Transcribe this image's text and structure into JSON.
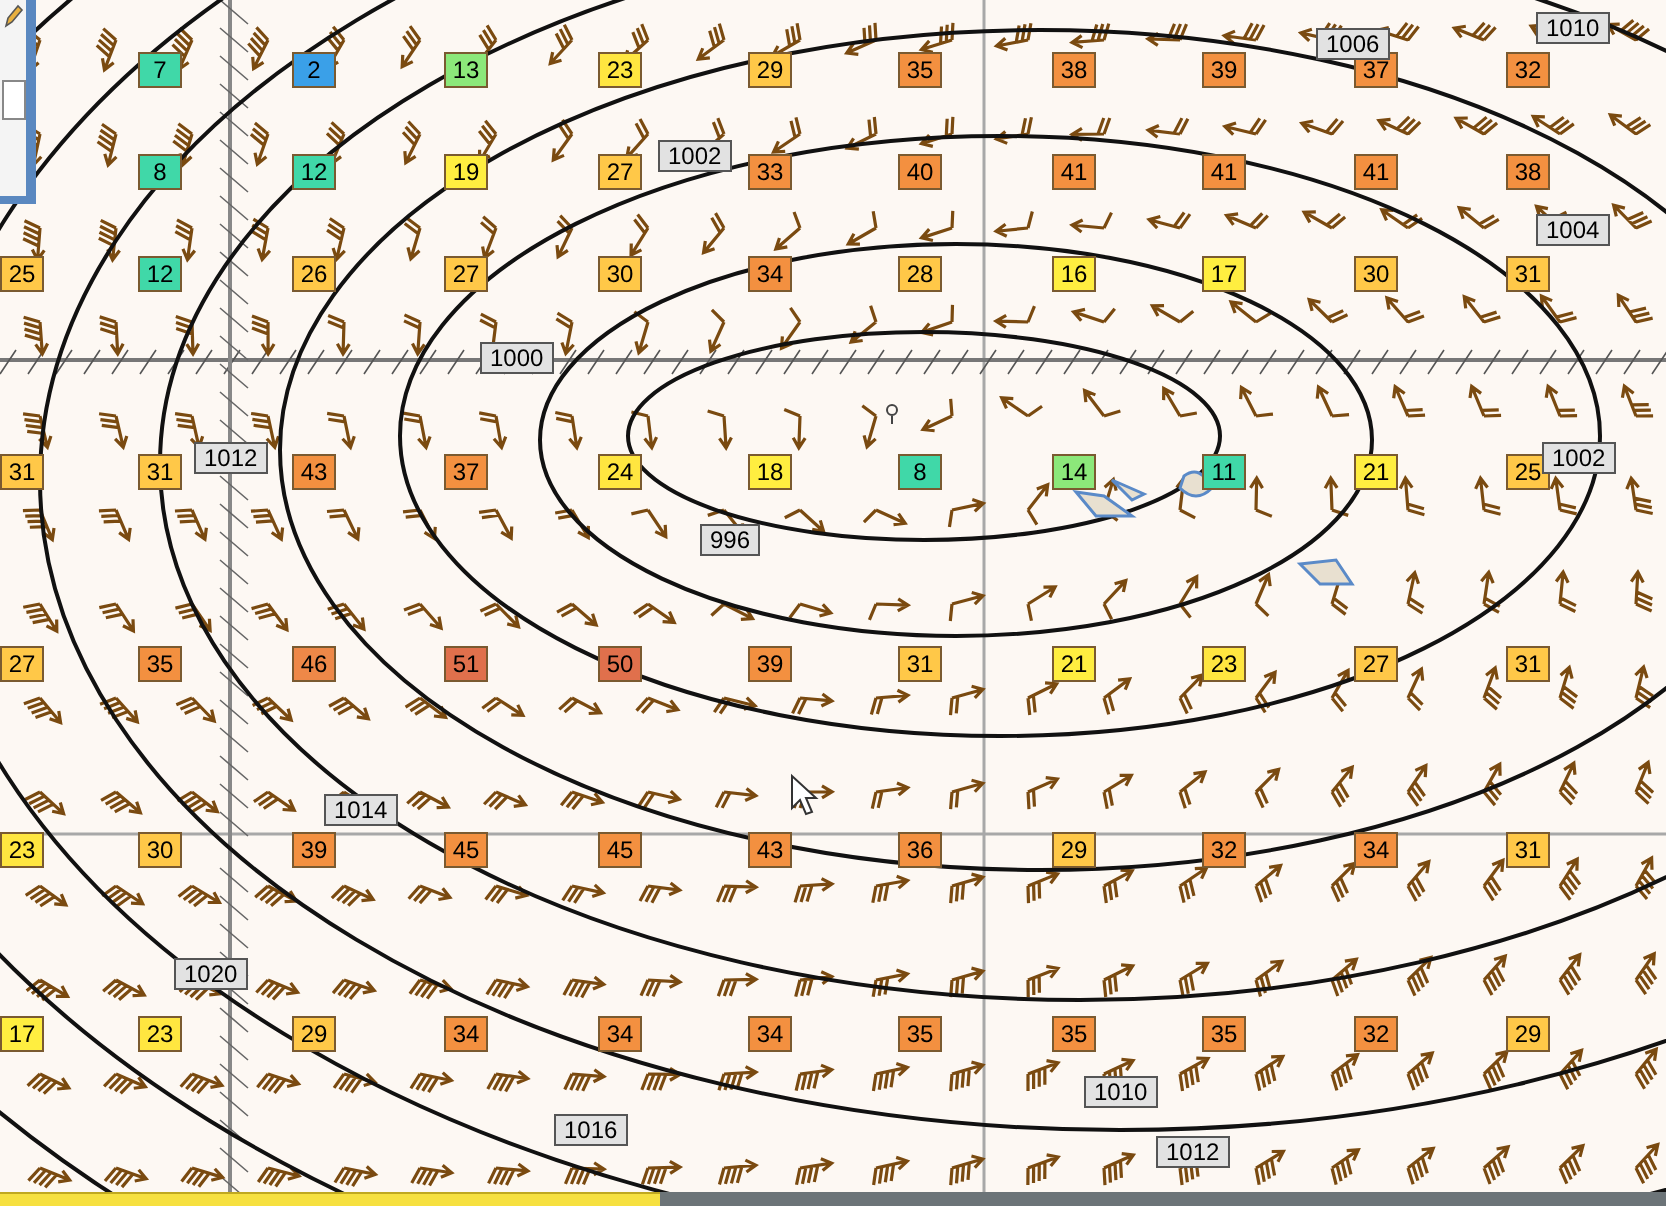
{
  "stations": [
    {
      "cells": [
        {
          "value": "7",
          "color": "#40d8a8"
        },
        {
          "value": "2",
          "color": "#3aa0e8"
        },
        {
          "value": "13",
          "color": "#8ce87a"
        },
        {
          "value": "23",
          "color": "#ffe640"
        },
        {
          "value": "29",
          "color": "#ffc848"
        },
        {
          "value": "35",
          "color": "#f39040"
        },
        {
          "value": "38",
          "color": "#f39040"
        },
        {
          "value": "39",
          "color": "#f39040"
        },
        {
          "value": "37",
          "color": "#f39040"
        },
        {
          "value": "32",
          "color": "#f39040"
        }
      ]
    },
    {
      "cells": [
        {
          "value": "8",
          "color": "#40d8a8"
        },
        {
          "value": "12",
          "color": "#40d8a8"
        },
        {
          "value": "19",
          "color": "#ffee40"
        },
        {
          "value": "27",
          "color": "#ffc848"
        },
        {
          "value": "33",
          "color": "#f39040"
        },
        {
          "value": "40",
          "color": "#f39040"
        },
        {
          "value": "41",
          "color": "#f39040"
        },
        {
          "value": "41",
          "color": "#f39040"
        },
        {
          "value": "41",
          "color": "#f39040"
        },
        {
          "value": "38",
          "color": "#f39040"
        }
      ]
    },
    {
      "cells": [
        {
          "value": "25",
          "color": "#ffc848"
        },
        {
          "value": "12",
          "color": "#40d8a8"
        },
        {
          "value": "26",
          "color": "#ffc848"
        },
        {
          "value": "27",
          "color": "#ffc848"
        },
        {
          "value": "30",
          "color": "#ffc848"
        },
        {
          "value": "34",
          "color": "#f39040"
        },
        {
          "value": "28",
          "color": "#ffc848"
        },
        {
          "value": "16",
          "color": "#ffee40"
        },
        {
          "value": "17",
          "color": "#ffee40"
        },
        {
          "value": "30",
          "color": "#ffc848"
        },
        {
          "value": "31",
          "color": "#ffc848"
        }
      ]
    },
    {
      "cells": [
        {
          "value": "31",
          "color": "#ffc848"
        },
        {
          "value": "31",
          "color": "#ffc848"
        },
        {
          "value": "43",
          "color": "#f39040"
        },
        {
          "value": "37",
          "color": "#f39040"
        },
        {
          "value": "24",
          "color": "#ffe640"
        },
        {
          "value": "18",
          "color": "#ffee40"
        },
        {
          "value": "8",
          "color": "#40d8a8"
        },
        {
          "value": "14",
          "color": "#8ce87a"
        },
        {
          "value": "11",
          "color": "#40d8a8"
        },
        {
          "value": "21",
          "color": "#ffee40"
        },
        {
          "value": "25",
          "color": "#ffc848"
        }
      ]
    },
    {
      "cells": [
        {
          "value": "27",
          "color": "#ffc848"
        },
        {
          "value": "35",
          "color": "#f39040"
        },
        {
          "value": "46",
          "color": "#ee8848"
        },
        {
          "value": "51",
          "color": "#e0704c"
        },
        {
          "value": "50",
          "color": "#e0704c"
        },
        {
          "value": "39",
          "color": "#f39040"
        },
        {
          "value": "31",
          "color": "#ffc848"
        },
        {
          "value": "21",
          "color": "#ffee40"
        },
        {
          "value": "23",
          "color": "#ffe640"
        },
        {
          "value": "27",
          "color": "#ffc848"
        },
        {
          "value": "31",
          "color": "#ffc848"
        }
      ]
    },
    {
      "cells": [
        {
          "value": "23",
          "color": "#ffe640"
        },
        {
          "value": "30",
          "color": "#ffc848"
        },
        {
          "value": "39",
          "color": "#f39040"
        },
        {
          "value": "45",
          "color": "#f39040"
        },
        {
          "value": "45",
          "color": "#f39040"
        },
        {
          "value": "43",
          "color": "#f39040"
        },
        {
          "value": "36",
          "color": "#f39040"
        },
        {
          "value": "29",
          "color": "#ffc848"
        },
        {
          "value": "32",
          "color": "#f39040"
        },
        {
          "value": "34",
          "color": "#f39040"
        },
        {
          "value": "31",
          "color": "#ffc848"
        }
      ]
    },
    {
      "cells": [
        {
          "value": "17",
          "color": "#ffee40"
        },
        {
          "value": "23",
          "color": "#ffe640"
        },
        {
          "value": "29",
          "color": "#ffc848"
        },
        {
          "value": "34",
          "color": "#f39040"
        },
        {
          "value": "34",
          "color": "#f39040"
        },
        {
          "value": "34",
          "color": "#f39040"
        },
        {
          "value": "35",
          "color": "#f39040"
        },
        {
          "value": "35",
          "color": "#f39040"
        },
        {
          "value": "35",
          "color": "#f39040"
        },
        {
          "value": "32",
          "color": "#f39040"
        },
        {
          "value": "29",
          "color": "#ffc848"
        }
      ]
    }
  ],
  "isobar_labels": [
    "1010",
    "1006",
    "1002",
    "1004",
    "1000",
    "1012",
    "1002",
    "996",
    "1014",
    "1020",
    "1010",
    "1016",
    "1012"
  ]
}
